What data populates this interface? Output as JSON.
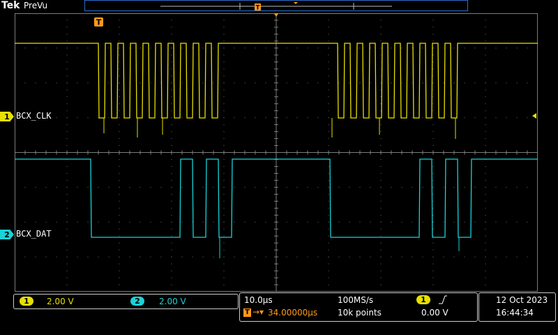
{
  "header": {
    "brand": "Tek",
    "acq_state": "PreVu",
    "trigger_icon": "T"
  },
  "channels": [
    {
      "number": "1",
      "label": "BCX_CLK",
      "color": "#e8e000",
      "scale": "2.00 V"
    },
    {
      "number": "2",
      "label": "BCX_DAT",
      "color": "#19d3d8",
      "scale": "2.00 V"
    }
  ],
  "horizontal": {
    "timebase": "10.0µs",
    "trigger_position": "34.00000µs",
    "sample_rate": "100MS/s",
    "record_length": "10k points"
  },
  "trigger": {
    "source": "1",
    "slope_icon": "rising-edge-icon",
    "level": "0.00 V"
  },
  "datetime": {
    "date": "12 Oct  2023",
    "time": "16:44:34"
  },
  "colors": {
    "ch1": "#e8e000",
    "ch2": "#19d3d8",
    "trigger": "#ff9a1a",
    "grid": "#8a8a8a",
    "frame": "#2a6fcf"
  }
}
